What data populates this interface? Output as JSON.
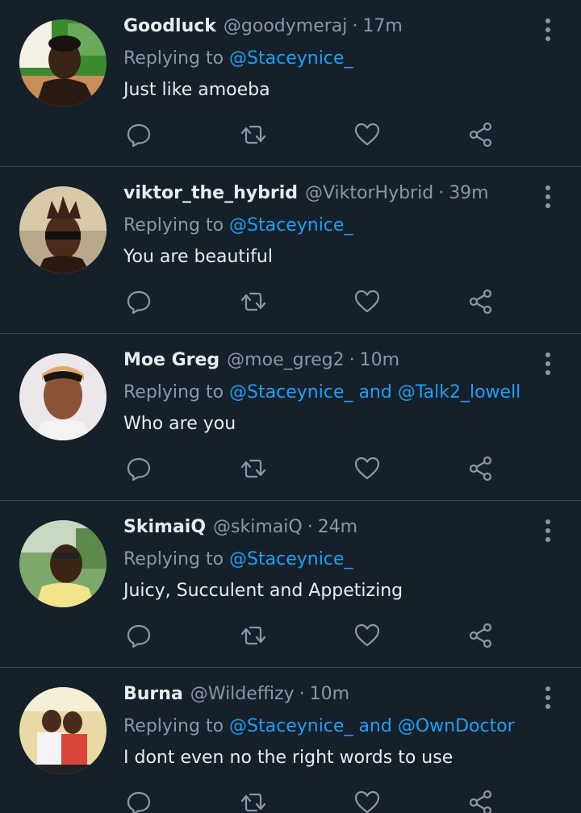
{
  "colors": {
    "background": "#15202b",
    "divider": "#38444d",
    "text_primary": "#e8ecef",
    "text_secondary": "#8899a6",
    "accent": "#1da1f2"
  },
  "icons": {
    "reply": "reply-icon",
    "retweet": "retweet-icon",
    "like": "heart-icon",
    "share": "share-icon",
    "more": "more-vertical-icon"
  },
  "replying_prefix": "Replying to",
  "conjunction": "and",
  "tweets": [
    {
      "name": "Goodluck",
      "handle": "@goodymeraj",
      "separator": "·",
      "time": "17m",
      "mentions": [
        "@Staceynice_"
      ],
      "text": "Just like amoeba"
    },
    {
      "name": "viktor_the_hybrid",
      "handle": "@ViktorHybrid",
      "separator": "·",
      "time": "39m",
      "mentions": [
        "@Staceynice_"
      ],
      "text": "You are beautiful"
    },
    {
      "name": "Moe Greg",
      "handle": "@moe_greg2",
      "separator": "·",
      "time": "10m",
      "mentions": [
        "@Staceynice_",
        "@Talk2_lowell"
      ],
      "text": "Who are you"
    },
    {
      "name": "SkimaiQ",
      "handle": "@skimaiQ",
      "separator": "·",
      "time": "24m",
      "mentions": [
        "@Staceynice_"
      ],
      "text": "Juicy, Succulent and Appetizing"
    },
    {
      "name": "Burna",
      "handle": "@Wildeffizy",
      "separator": "·",
      "time": "10m",
      "mentions": [
        "@Staceynice_",
        "@OwnDoctor"
      ],
      "text": "I dont even no the right words to use"
    }
  ]
}
